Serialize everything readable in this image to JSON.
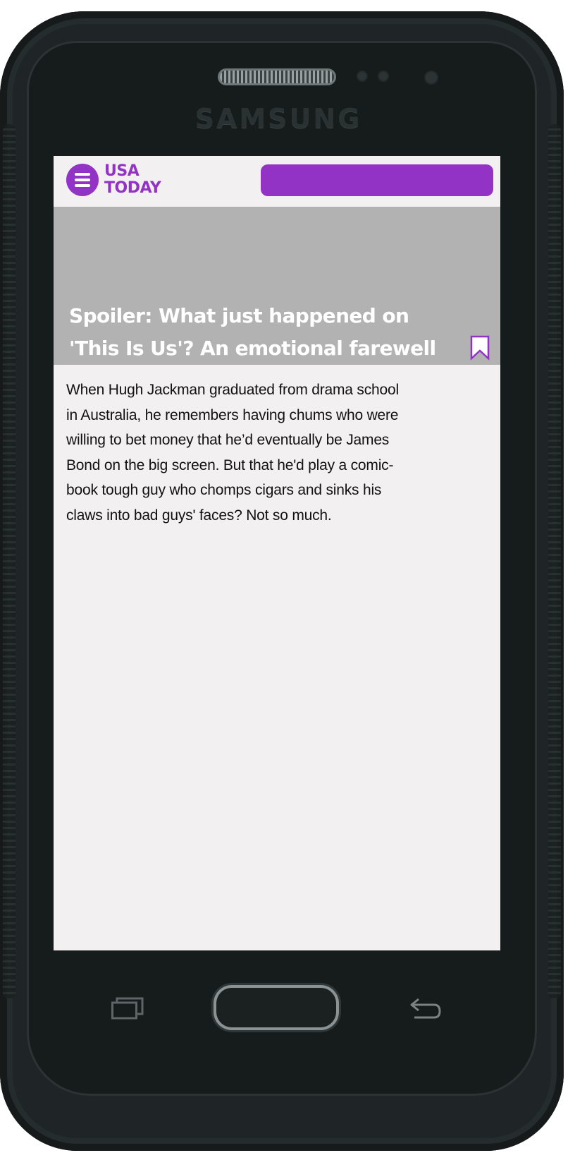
{
  "device": {
    "brand_label": "SAMSUNG"
  },
  "header": {
    "logo_line1": "USA",
    "logo_line2": "TODAY",
    "menu_icon": "hamburger-menu-icon",
    "accent_color": "#9333c6"
  },
  "article": {
    "headline": "Spoiler: What just happened on 'This Is Us'? An emotional farewell",
    "headline_line1": "Spoiler: What just happened on",
    "headline_line2": "'This Is Us'? An emotional farewell",
    "bookmark_icon": "bookmark-icon",
    "body_lines": [
      "When Hugh Jackman graduated from drama school",
      "in Australia, he remembers having chums who were",
      "willing to bet money that he’d eventually be James",
      "Bond on the big screen. But that he'd play a comic-",
      "book tough guy who chomps cigars and sinks his",
      "claws into bad guys' faces? Not so much."
    ]
  },
  "nav_keys": {
    "recent": "recent-apps-icon",
    "home": "home-button",
    "back": "back-arrow-icon"
  }
}
